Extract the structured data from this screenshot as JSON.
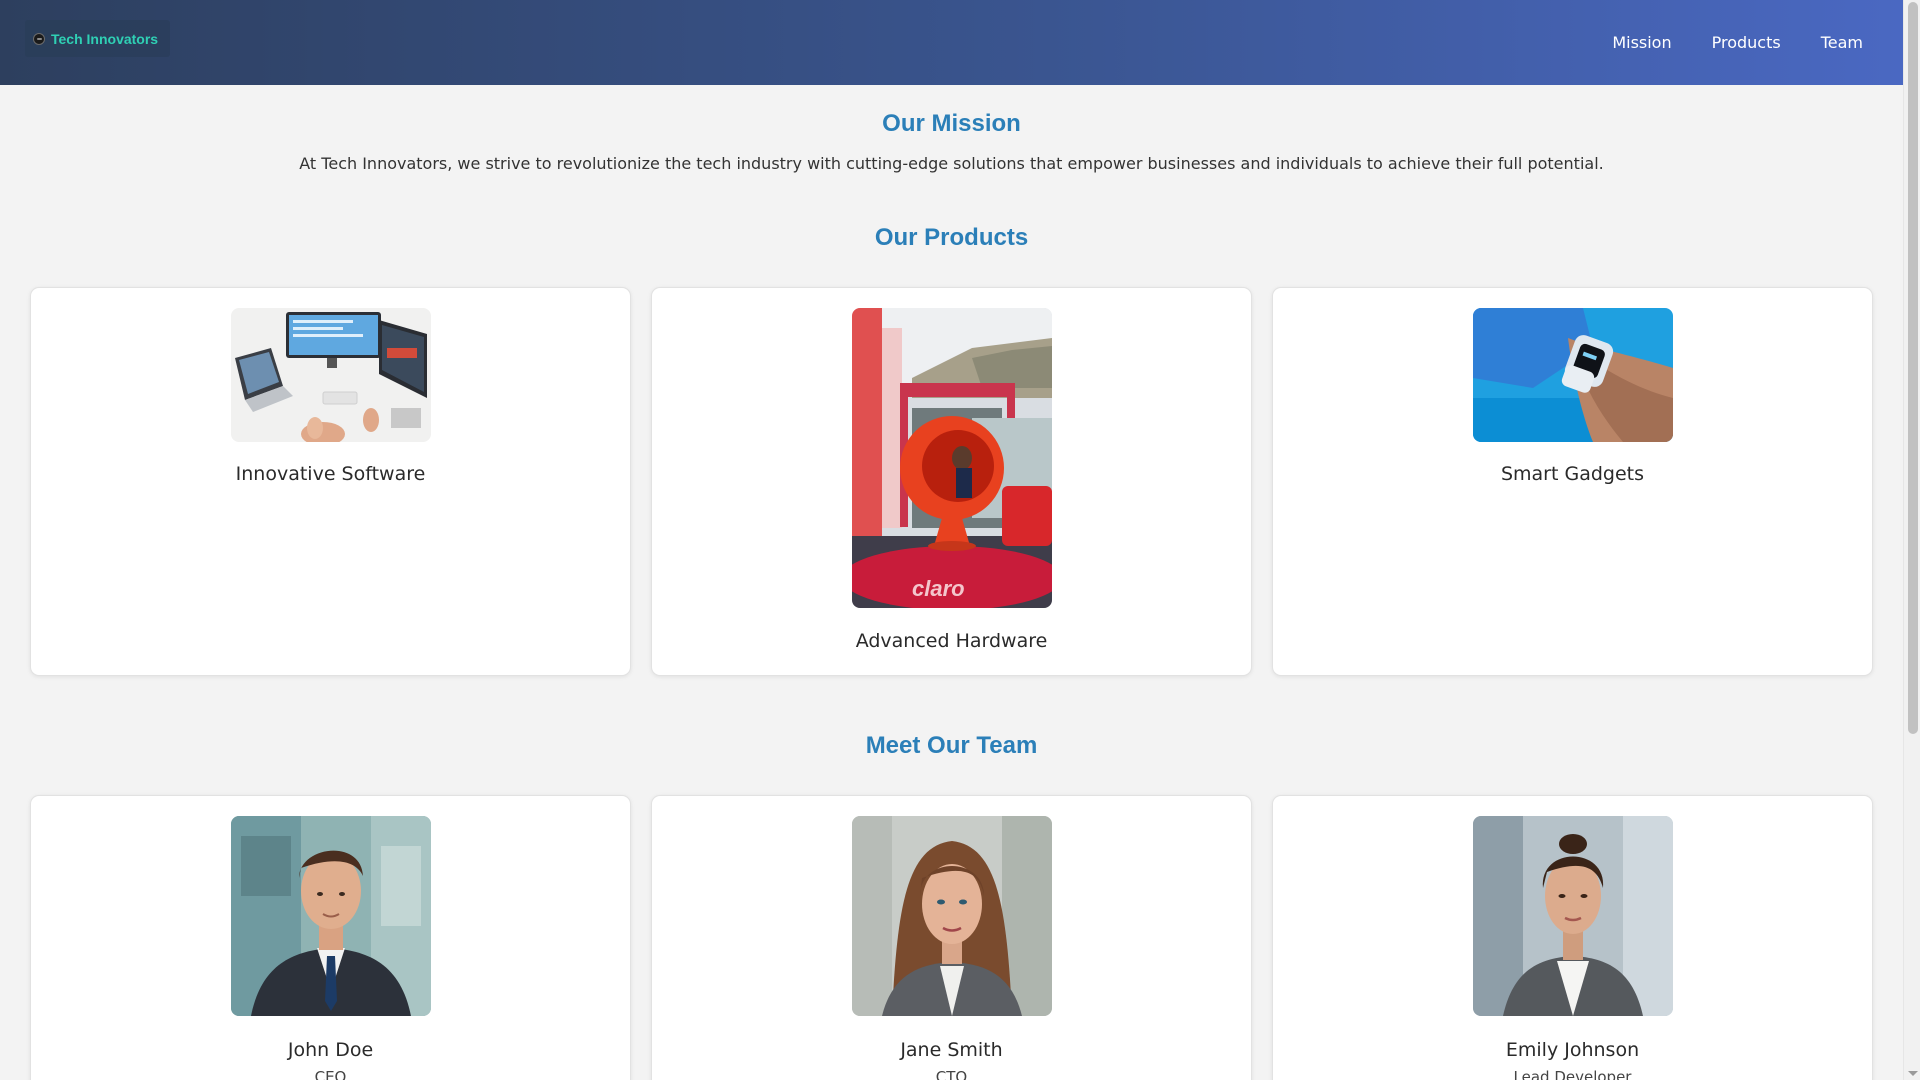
{
  "brand": {
    "name": "Tech Innovators",
    "icon": "logo-icon"
  },
  "nav": {
    "items": [
      "Mission",
      "Products",
      "Team"
    ]
  },
  "mission": {
    "title": "Our Mission",
    "text": "At Tech Innovators, we strive to revolutionize the tech industry with cutting-edge solutions that empower businesses and individuals to achieve their full potential."
  },
  "products": {
    "title": "Our Products",
    "items": [
      {
        "name": "Innovative Software",
        "image": "workstation-photo"
      },
      {
        "name": "Advanced Hardware",
        "image": "red-egg-chair-photo"
      },
      {
        "name": "Smart Gadgets",
        "image": "smartwatch-photo"
      }
    ]
  },
  "team": {
    "title": "Meet Our Team",
    "members": [
      {
        "name": "John Doe",
        "role": "CEO",
        "image": "john-doe-portrait"
      },
      {
        "name": "Jane Smith",
        "role": "CTO",
        "image": "jane-smith-portrait"
      },
      {
        "name": "Emily Johnson",
        "role": "Lead Developer",
        "image": "emily-johnson-portrait"
      }
    ]
  },
  "colors": {
    "accent": "#2b7fb8",
    "brand_text": "#2fd0b4",
    "header_start": "#2d3f5e",
    "header_end": "#4a68c2",
    "background": "#f3f3f3"
  }
}
